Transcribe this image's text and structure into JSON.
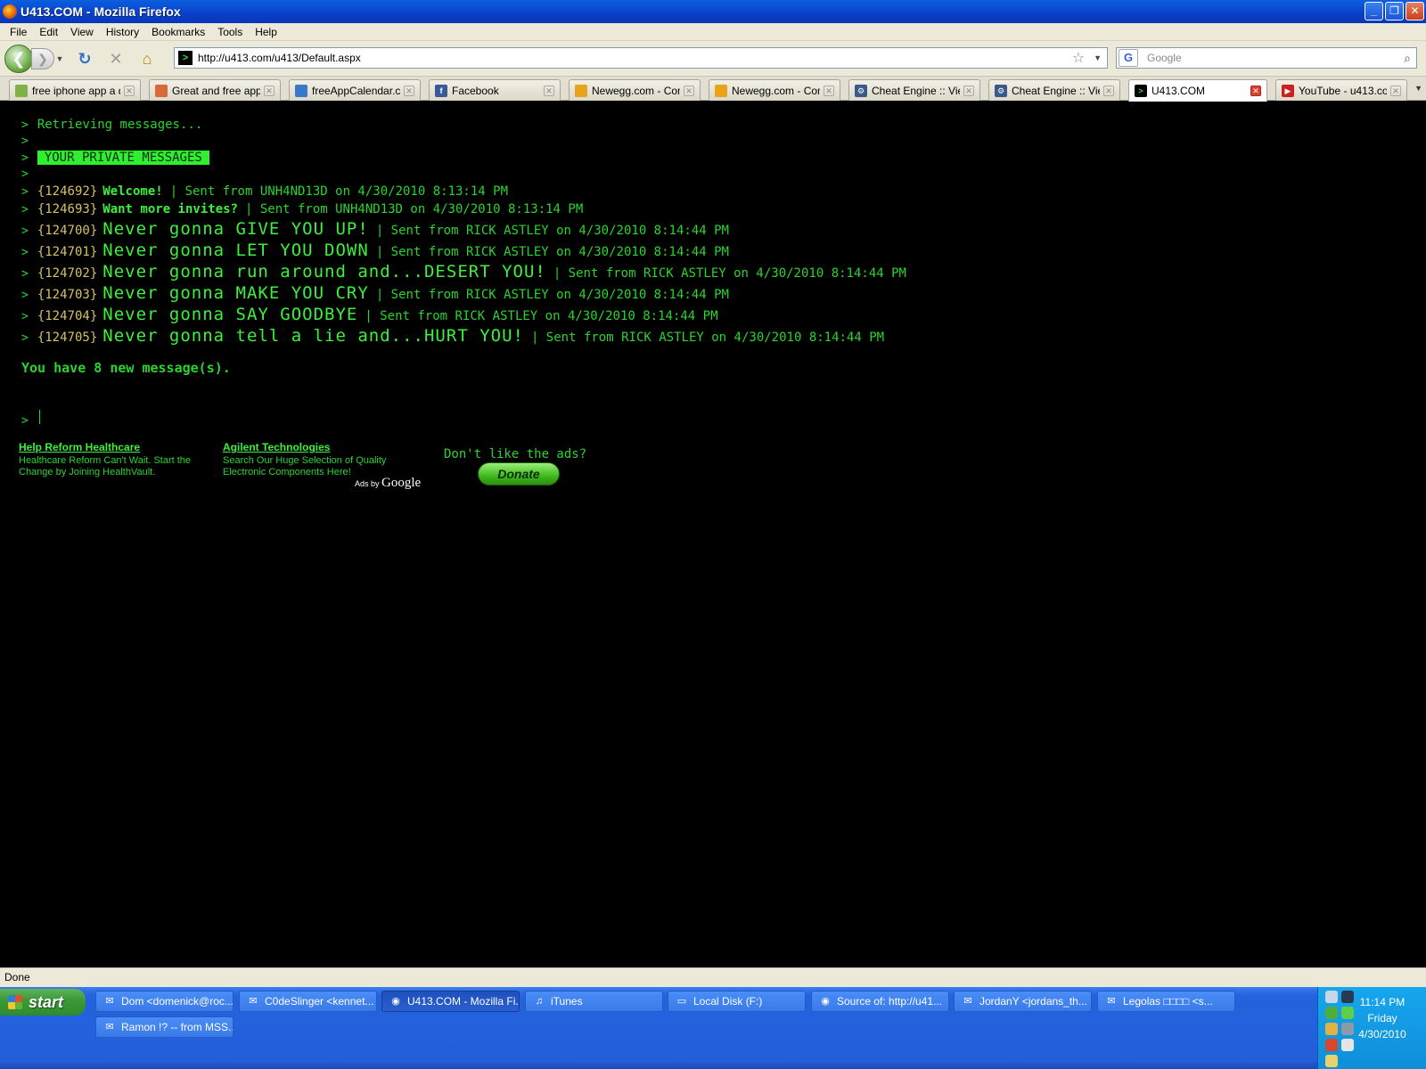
{
  "window": {
    "title": "U413.COM - Mozilla Firefox"
  },
  "menu": [
    "File",
    "Edit",
    "View",
    "History",
    "Bookmarks",
    "Tools",
    "Help"
  ],
  "navbar": {
    "url": "http://u413.com/u413/Default.aspx",
    "search_placeholder": "Google"
  },
  "tabs": [
    {
      "label": "free iphone app a d...",
      "icon": "app-icon",
      "color": "#7fb14a"
    },
    {
      "label": "Great and free app...",
      "icon": "mascot-icon",
      "color": "#d66a3a"
    },
    {
      "label": "freeAppCalendar.c...",
      "icon": "calendar-icon",
      "color": "#3a78c9"
    },
    {
      "label": "Facebook",
      "icon": "facebook-icon",
      "color": "#3b5998"
    },
    {
      "label": "Newegg.com - Com...",
      "icon": "newegg-icon",
      "color": "#e8a21c"
    },
    {
      "label": "Newegg.com - Com...",
      "icon": "newegg-icon",
      "color": "#e8a21c"
    },
    {
      "label": "Cheat Engine :: Vie...",
      "icon": "gear-icon",
      "color": "#3a5a8a"
    },
    {
      "label": "Cheat Engine :: Vie...",
      "icon": "gear-icon",
      "color": "#3a5a8a"
    },
    {
      "label": "U413.COM",
      "icon": "terminal-icon",
      "color": "#000000",
      "active": true
    },
    {
      "label": "YouTube - u413.co...",
      "icon": "youtube-icon",
      "color": "#cc2020"
    }
  ],
  "terminal": {
    "prompt": ">",
    "retrieving": "Retrieving messages...",
    "banner": "YOUR PRIVATE MESSAGES",
    "messages": [
      {
        "id": "{124692}",
        "subject": "Welcome!",
        "meta": "| Sent from UNH4ND13D on 4/30/2010 8:13:14 PM",
        "big": false
      },
      {
        "id": "{124693}",
        "subject": "Want more invites?",
        "meta": "| Sent from UNH4ND13D on 4/30/2010 8:13:14 PM",
        "big": false
      },
      {
        "id": "{124700}",
        "subject": "Never gonna GIVE YOU UP!",
        "meta": "| Sent from RICK ASTLEY on 4/30/2010 8:14:44 PM",
        "big": true
      },
      {
        "id": "{124701}",
        "subject": "Never gonna LET YOU DOWN",
        "meta": "| Sent from RICK ASTLEY on 4/30/2010 8:14:44 PM",
        "big": true
      },
      {
        "id": "{124702}",
        "subject": "Never gonna run around and...DESERT YOU!",
        "meta": "| Sent from RICK ASTLEY on 4/30/2010 8:14:44 PM",
        "big": true
      },
      {
        "id": "{124703}",
        "subject": "Never gonna MAKE YOU CRY",
        "meta": "| Sent from RICK ASTLEY on 4/30/2010 8:14:44 PM",
        "big": true
      },
      {
        "id": "{124704}",
        "subject": "Never gonna SAY GOODBYE",
        "meta": "| Sent from RICK ASTLEY on 4/30/2010 8:14:44 PM",
        "big": true
      },
      {
        "id": "{124705}",
        "subject": "Never gonna tell a lie and...HURT YOU!",
        "meta": "| Sent from RICK ASTLEY on 4/30/2010 8:14:44 PM",
        "big": true
      }
    ],
    "summary": "You have 8 new message(s)."
  },
  "ads": [
    {
      "title": "Help Reform Healthcare",
      "line1": "Healthcare Reform Can't Wait. Start the",
      "line2": "Change by Joining HealthVault."
    },
    {
      "title": "Agilent Technologies",
      "line1": "Search Our Huge Selection of Quality",
      "line2": "Electronic Components Here!"
    }
  ],
  "ads_by": {
    "prefix": "Ads by",
    "brand": "Google"
  },
  "donate": {
    "prompt": "Don't like the ads?",
    "button": "Donate"
  },
  "status": "Done",
  "taskbar": {
    "start": "start",
    "tasks": [
      {
        "label": "Dom <domenick@roc...",
        "icon": "chat-icon"
      },
      {
        "label": "C0deSlinger <kennet...",
        "icon": "chat-icon"
      },
      {
        "label": "U413.COM - Mozilla Fi...",
        "icon": "firefox-icon",
        "active": true
      },
      {
        "label": "iTunes",
        "icon": "itunes-icon"
      },
      {
        "label": "Local Disk (F:)",
        "icon": "disk-icon"
      },
      {
        "label": "Source of: http://u41...",
        "icon": "firefox-icon"
      },
      {
        "label": "JordanY <jordans_th...",
        "icon": "chat-icon"
      },
      {
        "label": "Legolas □□□□ <s...",
        "icon": "chat-icon"
      },
      {
        "label": "Ramon !? -- from MSS...",
        "icon": "chat-icon"
      }
    ],
    "clock": {
      "time": "11:14 PM",
      "day": "Friday",
      "date": "4/30/2010"
    }
  }
}
